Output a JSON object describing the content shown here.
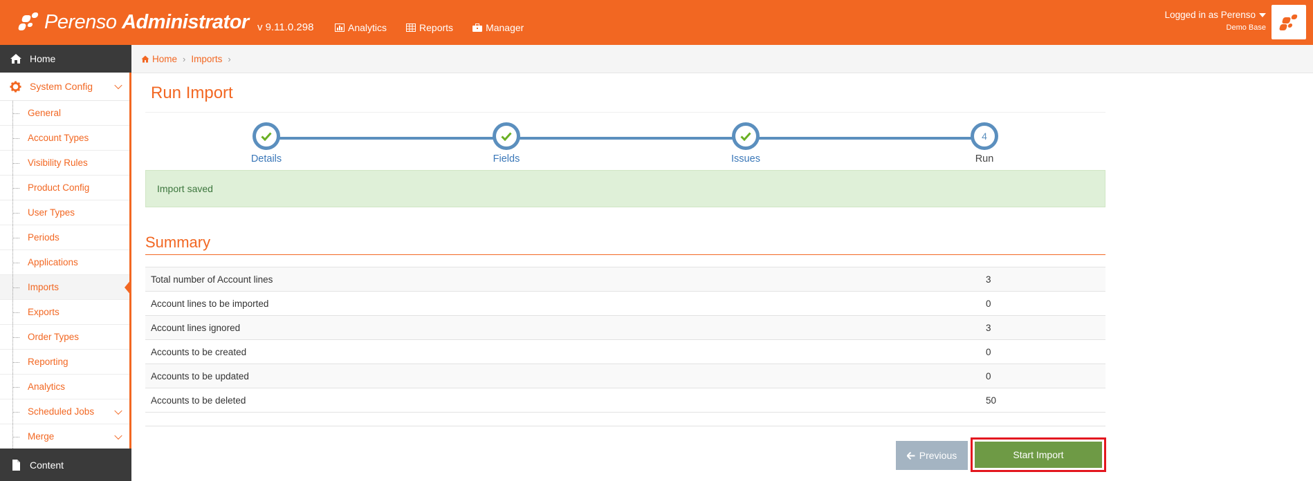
{
  "header": {
    "brand_light": "Perenso",
    "brand_bold": "Administrator",
    "version": "v 9.11.0.298",
    "nav": [
      {
        "label": "Analytics",
        "icon": "chart-icon"
      },
      {
        "label": "Reports",
        "icon": "table-icon"
      },
      {
        "label": "Manager",
        "icon": "briefcase-icon"
      }
    ],
    "user_label": "Logged in as Perenso",
    "user_base": "Demo Base"
  },
  "sidebar": {
    "home": "Home",
    "system_config": "System Config",
    "items": [
      {
        "label": "General"
      },
      {
        "label": "Account Types"
      },
      {
        "label": "Visibility Rules"
      },
      {
        "label": "Product Config"
      },
      {
        "label": "User Types"
      },
      {
        "label": "Periods"
      },
      {
        "label": "Applications"
      },
      {
        "label": "Imports",
        "active": true
      },
      {
        "label": "Exports"
      },
      {
        "label": "Order Types"
      },
      {
        "label": "Reporting"
      },
      {
        "label": "Analytics"
      },
      {
        "label": "Scheduled Jobs",
        "expandable": true
      },
      {
        "label": "Merge",
        "expandable": true
      }
    ],
    "content": "Content"
  },
  "breadcrumb": [
    "Home",
    "Imports"
  ],
  "page": {
    "title": "Run Import",
    "steps": [
      {
        "label": "Details",
        "status": "done"
      },
      {
        "label": "Fields",
        "status": "done"
      },
      {
        "label": "Issues",
        "status": "done"
      },
      {
        "label": "Run",
        "status": "current",
        "number": "4"
      }
    ],
    "alert": "Import saved",
    "summary_title": "Summary",
    "summary_rows": [
      {
        "label": "Total number of Account lines",
        "value": "3"
      },
      {
        "label": "Account lines to be imported",
        "value": "0"
      },
      {
        "label": "Account lines ignored",
        "value": "3"
      },
      {
        "label": "Accounts to be created",
        "value": "0"
      },
      {
        "label": "Accounts to be updated",
        "value": "0"
      },
      {
        "label": "Accounts to be deleted",
        "value": "50"
      }
    ],
    "previous_button": "Previous",
    "start_button": "Start Import"
  },
  "colors": {
    "brand": "#f26722",
    "step": "#5b8fbe",
    "check": "#6ab023",
    "start_button": "#6e9a45",
    "highlight": "#e3171f"
  }
}
